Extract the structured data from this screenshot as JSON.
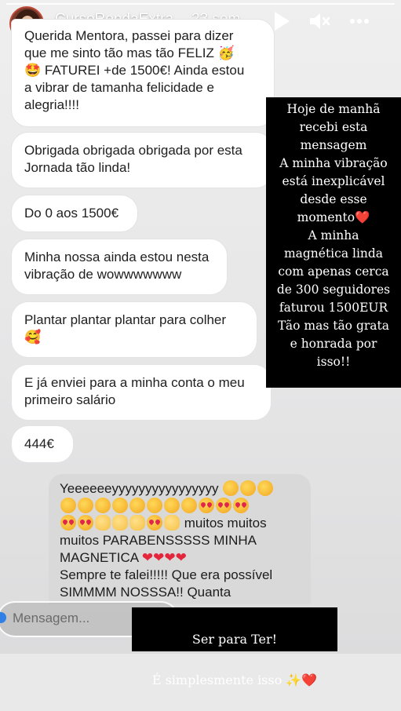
{
  "header": {
    "username": "CursoRendaExtra",
    "time": "23 sem"
  },
  "messages": [
    {
      "text": "Querida Mentora, passei para dizer\nque me sinto tão mas tão FELIZ 🥳\n🤩 FATUREI +de 1500€! Ainda estou\na vibrar de tamanha felicidade e\nalegria!!!!"
    },
    {
      "text": "Obrigada obrigada obrigada por esta\nJornada tão linda!"
    },
    {
      "text": "Do 0 aos 1500€"
    },
    {
      "text": "Minha nossa ainda estou nesta\nvibração de wowwwwwww"
    },
    {
      "text": "Plantar plantar plantar para colher\n🥰"
    },
    {
      "text": "E já enviei para a minha conta o meu\nprimeiro salário"
    },
    {
      "text": "444€"
    }
  ],
  "reply": {
    "line1": "Yeeeeeeyyyyyyyyyyyyyyyy",
    "line3_text": "muitos muitos",
    "line4": "muitos PARABENSSSSS MINHA",
    "line5": "MAGNETICA",
    "line6": "Sempre te falei!!!!! Que era possível",
    "line7": "SIMMMM NOSSSA!! Quanta"
  },
  "overlay": {
    "text": "Hoje de manhã\nrecebi esta\nmensagem\nA minha vibração\nestá inexplicável\ndesde esse\nmomento❤️\nA minha\nmagnética linda\ncom apenas cerca\nde 300 seguidores\nfaturou 1500EUR\nTão mas tão grata\ne honrada por\nisso!!"
  },
  "overlay_bottom": {
    "line1": "Ser para Ter!",
    "line2": "É simplesmente isso ✨❤️"
  },
  "input": {
    "placeholder": "Mensagem..."
  },
  "icons": [
    "play-icon",
    "mute-icon",
    "more-icon",
    "camera-icon"
  ]
}
